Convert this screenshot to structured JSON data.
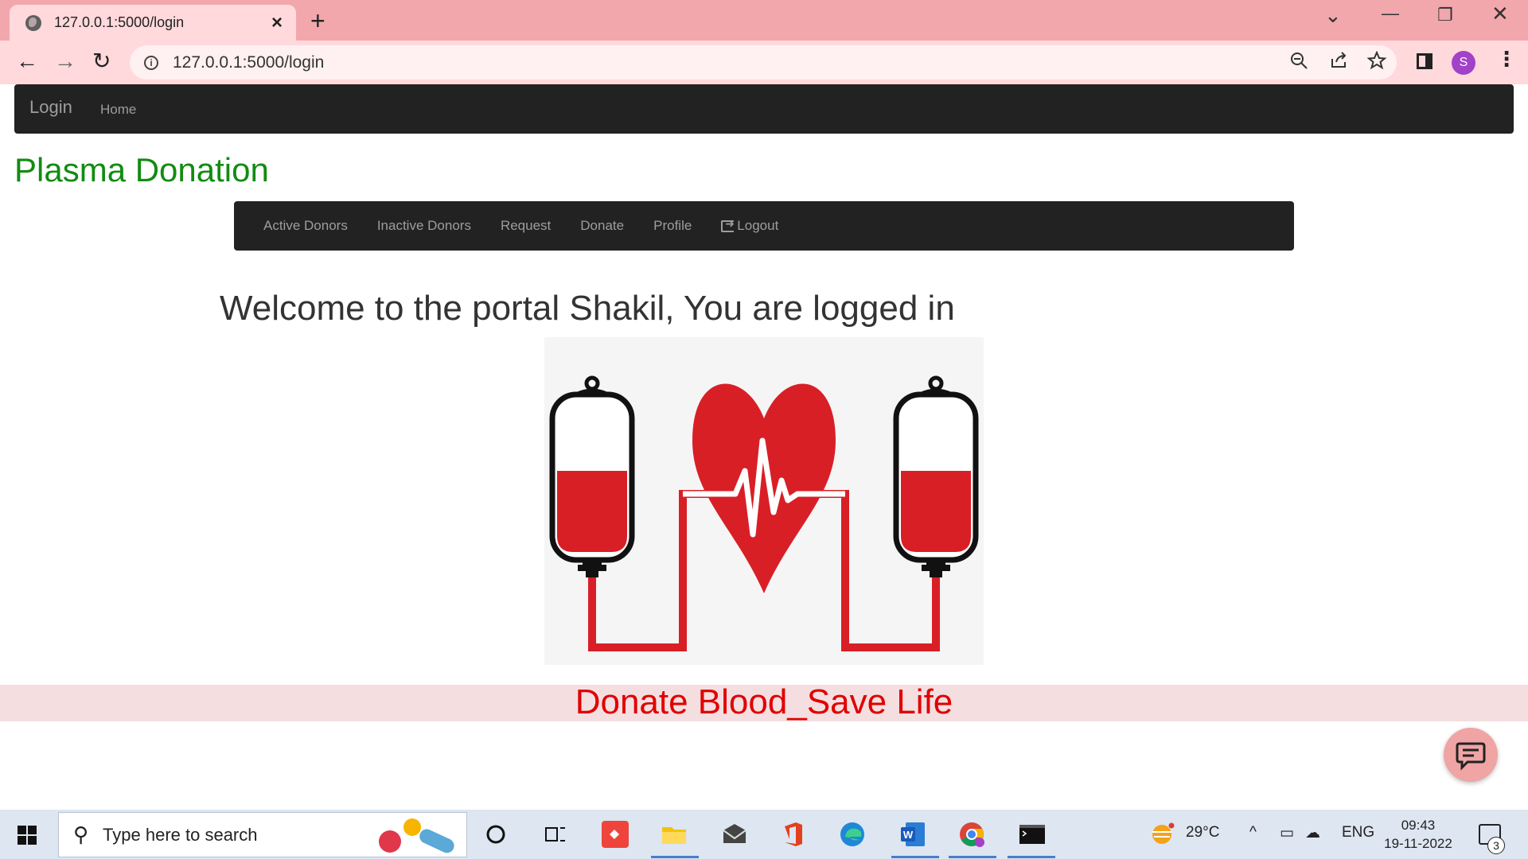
{
  "browser": {
    "tab_title": "127.0.0.1:5000/login",
    "new_tab_symbol": "+",
    "address_url": "127.0.0.1:5000/login",
    "profile_initial": "S"
  },
  "page": {
    "brand": "Login",
    "top_nav": {
      "home": "Home"
    },
    "site_title": "Plasma Donation",
    "menu": [
      {
        "label": "Active Donors"
      },
      {
        "label": "Inactive Donors"
      },
      {
        "label": "Request"
      },
      {
        "label": "Donate"
      },
      {
        "label": "Profile"
      },
      {
        "label": "Logout"
      }
    ],
    "welcome": "Welcome to the portal Shakil, You are logged in",
    "slogan": "Donate Blood_Save Life",
    "colors": {
      "nav_bg": "#222222",
      "title_green": "#118c11",
      "slogan_red": "#e00000",
      "blood_red": "#d91f26"
    }
  },
  "taskbar": {
    "search_placeholder": "Type here to search",
    "weather": "29°C",
    "language": "ENG",
    "time": "09:43",
    "date": "19-11-2022",
    "notification_count": "3"
  }
}
